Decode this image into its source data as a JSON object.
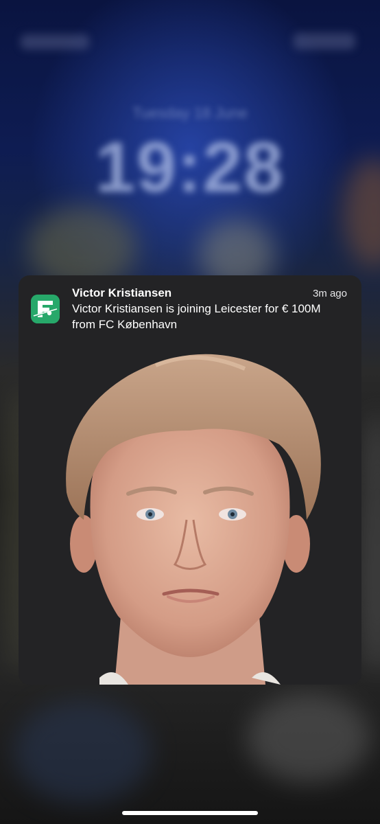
{
  "lock_screen": {
    "date": "Tuesday 18 June",
    "time": "19:28"
  },
  "notification": {
    "app_icon": "football-app-icon",
    "title": "Victor Kristiansen",
    "time": "3m ago",
    "body": "Victor Kristiansen is joining Leicester for € 100M from FC København",
    "attachment": "player-headshot-image",
    "colors": {
      "card_bg": "#232325",
      "icon_green": "#27a86a"
    }
  },
  "system": {
    "home_indicator": "home-indicator"
  }
}
